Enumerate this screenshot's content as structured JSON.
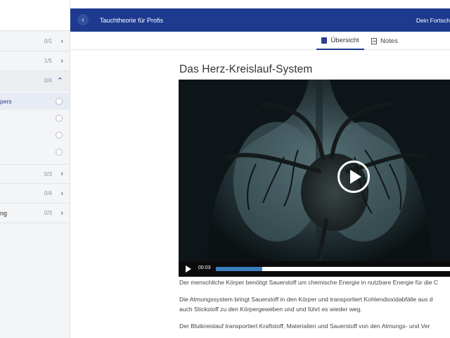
{
  "sidebar": {
    "sections": [
      {
        "label": "",
        "count": "0/1",
        "expanded": false
      },
      {
        "label": "",
        "count": "1/5",
        "expanded": false
      },
      {
        "label": "",
        "count": "0/4",
        "expanded": true
      },
      {
        "label": "",
        "count": "0/3",
        "expanded": false
      },
      {
        "label": "",
        "count": "0/4",
        "expanded": false
      },
      {
        "label": "ng",
        "count": "0/3",
        "expanded": false
      }
    ],
    "lessons": [
      {
        "label": "pers",
        "active": true
      },
      {
        "label": "",
        "active": false
      },
      {
        "label": "",
        "active": false
      },
      {
        "label": "",
        "active": false
      }
    ]
  },
  "header": {
    "course_title": "Tauchtheorie für Profis",
    "progress_label": "Dein Fortsch"
  },
  "tabs": [
    {
      "label": "Übersicht",
      "icon": "book-icon",
      "active": true
    },
    {
      "label": "Notes",
      "icon": "note-icon",
      "active": false
    }
  ],
  "lesson": {
    "title": "Das Herz-Kreislauf-System",
    "video": {
      "current_time": "00:03",
      "progress": 0.19
    },
    "paragraphs": [
      [
        "Der menschliche Körper benötigt Sauerstoff um chemische Energie in nutzbare Energie für die C"
      ],
      [
        "Die Atmungssystem bringt Sauerstoff in den Körper und transportiert Kohlendioxidabfälle aus d",
        "auch Stickstoff zu den Körpergeweben und und führt es wieder weg."
      ],
      [
        "Der Blutkreislauf transportiert Kraftstoff, Materialien und Sauerstoff von den Atmungs- und Ver"
      ]
    ]
  },
  "colors": {
    "brand": "#1d3a8f",
    "progress": "#3c7fc0"
  }
}
